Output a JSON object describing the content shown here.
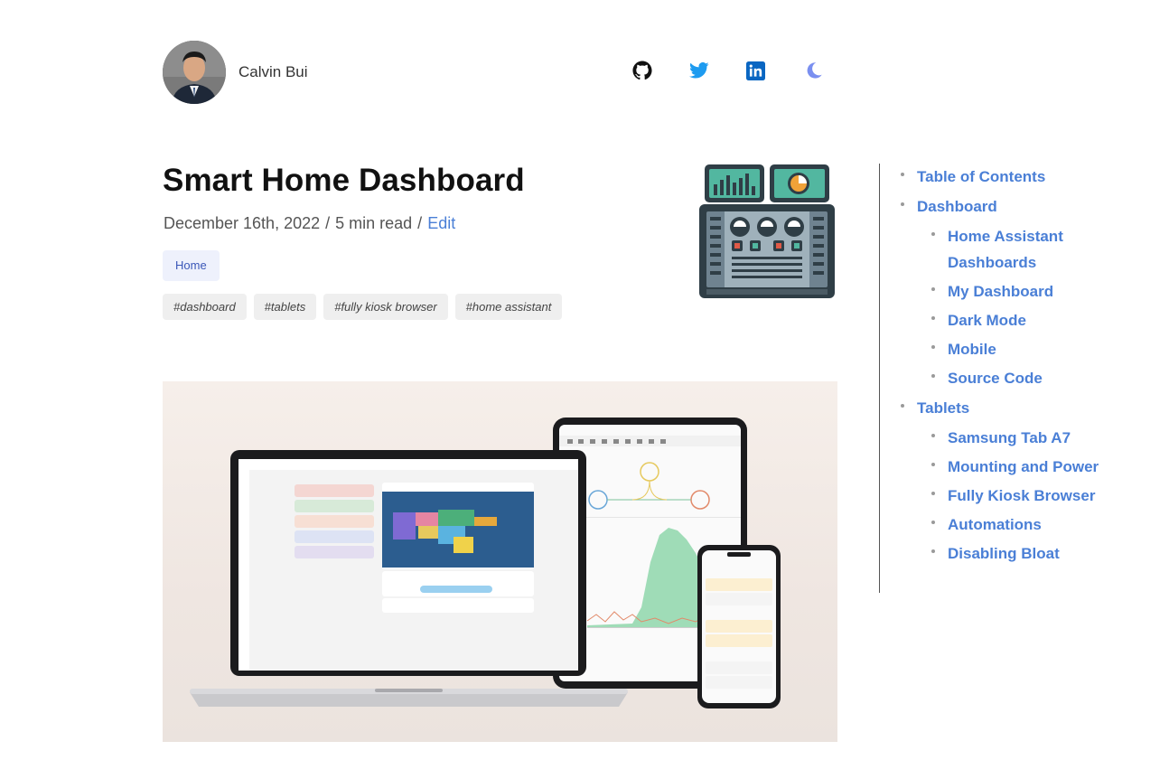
{
  "author": {
    "name": "Calvin Bui"
  },
  "social": [
    {
      "name": "github-icon"
    },
    {
      "name": "twitter-icon"
    },
    {
      "name": "linkedin-icon"
    },
    {
      "name": "moon-icon"
    }
  ],
  "post": {
    "title": "Smart Home Dashboard",
    "date": "December 16th, 2022",
    "sep1": "/",
    "read_time": "5 min read",
    "sep2": "/",
    "edit_label": "Edit",
    "category": "Home",
    "tags": [
      "#dashboard",
      "#tablets",
      "#fully kiosk browser",
      "#home assistant"
    ]
  },
  "toc": {
    "items": [
      {
        "label": "Table of Contents"
      },
      {
        "label": "Dashboard",
        "children": [
          {
            "label": "Home Assistant Dashboards"
          },
          {
            "label": "My Dashboard"
          },
          {
            "label": "Dark Mode"
          },
          {
            "label": "Mobile"
          },
          {
            "label": "Source Code"
          }
        ]
      },
      {
        "label": "Tablets",
        "children": [
          {
            "label": "Samsung Tab A7"
          },
          {
            "label": "Mounting and Power"
          },
          {
            "label": "Fully Kiosk Browser"
          },
          {
            "label": "Automations"
          },
          {
            "label": "Disabling Bloat"
          }
        ]
      }
    ]
  },
  "colors": {
    "link": "#4a7fd6",
    "category_bg": "#eef1fc",
    "tag_bg": "#efefef"
  }
}
